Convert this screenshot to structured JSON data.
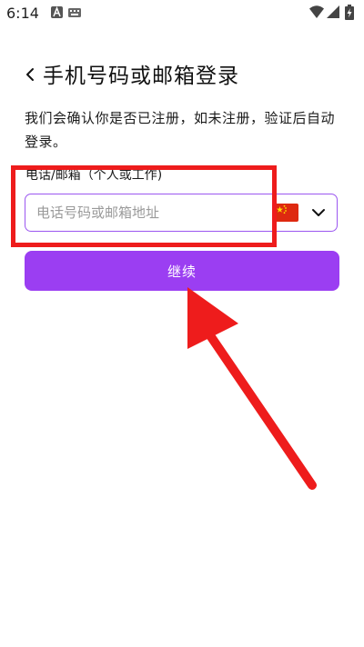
{
  "status_bar": {
    "time": "6:14",
    "icons": [
      "notification-a-icon",
      "keyboard-icon",
      "wifi-icon",
      "signal-icon",
      "battery-charging-icon"
    ]
  },
  "header": {
    "back_icon": "chevron-left-icon",
    "title": "手机号码或邮箱登录"
  },
  "description": "我们会确认你是否已注册，如未注册，验证后自动登录。",
  "form": {
    "label": "电话/邮箱（个人或工作)",
    "input_placeholder": "电话号码或邮箱地址",
    "input_value": "",
    "country_flag": "china-flag-icon",
    "dropdown_icon": "chevron-down-icon",
    "accent_color": "#9b57f0"
  },
  "continue_button": {
    "label": "继续",
    "color": "#9b3ef2"
  },
  "annotations": {
    "color": "#ee1c1c",
    "items": [
      "highlight-box",
      "pointer-arrow"
    ]
  }
}
